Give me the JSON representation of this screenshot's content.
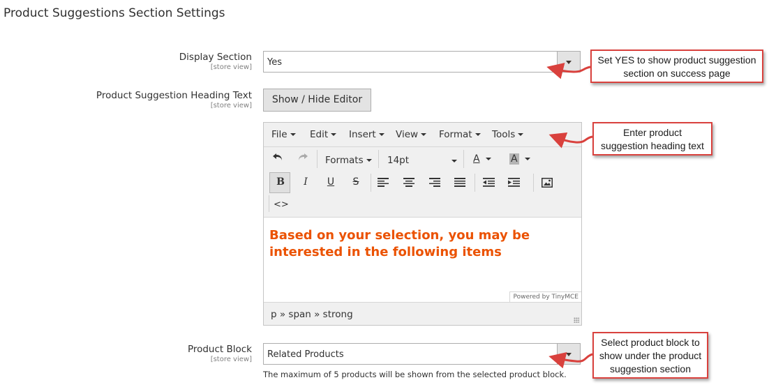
{
  "section": {
    "title": "Product Suggestions Section Settings"
  },
  "display_section": {
    "label": "Display Section",
    "scope": "[store view]",
    "value": "Yes"
  },
  "heading_text": {
    "label": "Product Suggestion Heading Text",
    "scope": "[store view]",
    "toggle_button": "Show / Hide Editor"
  },
  "editor": {
    "menus": [
      "File",
      "Edit",
      "Insert",
      "View",
      "Format",
      "Tools"
    ],
    "toolbar": {
      "formats": "Formats",
      "font_size": "14pt",
      "text_color_glyph": "A",
      "bg_color_glyph": "A",
      "icons": [
        "undo-icon",
        "redo-icon",
        "bold-icon",
        "italic-icon",
        "underline-icon",
        "strikethrough-icon",
        "align-left-icon",
        "align-center-icon",
        "align-right-icon",
        "align-justify-icon",
        "outdent-icon",
        "indent-icon",
        "image-icon",
        "source-code-icon"
      ]
    },
    "content": "Based on your selection, you may be interested in the following items",
    "powered_by": "Powered by TinyMCE",
    "path": "p » span » strong"
  },
  "product_block": {
    "label": "Product Block",
    "scope": "[store view]",
    "value": "Related Products",
    "note": "The maximum of 5 products will be shown from the selected product block."
  },
  "callouts": {
    "display": [
      "Set YES to show product suggestion",
      "section on success page"
    ],
    "heading": [
      "Enter product",
      "suggestion heading text"
    ],
    "block": [
      "Select product block to",
      "show under the product",
      "suggestion section"
    ]
  },
  "colors": {
    "accent": "#eb5202",
    "callout_border": "#d9413d"
  }
}
